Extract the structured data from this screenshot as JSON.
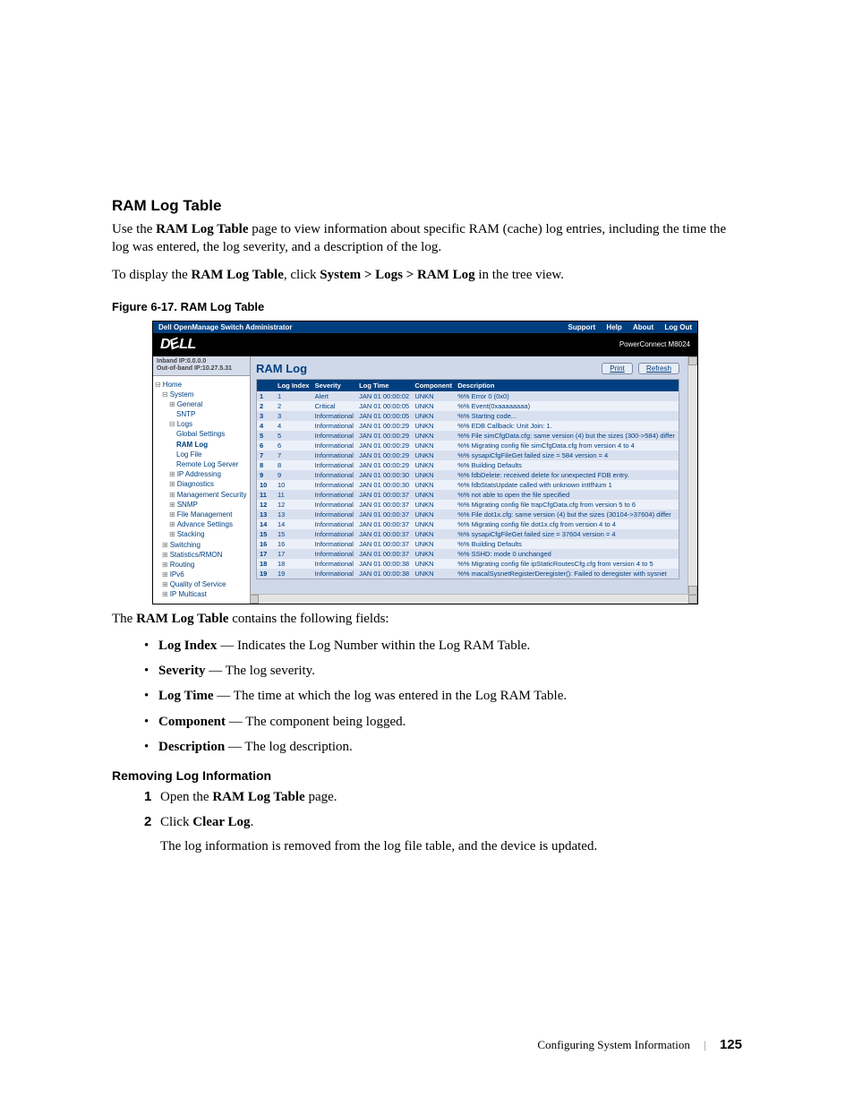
{
  "section": {
    "title": "RAM Log Table",
    "intro_pre": "Use the ",
    "intro_bold1": "RAM Log Table",
    "intro_post": " page to view information about specific RAM (cache) log entries, including the time the log was entered, the log severity, and a description of the log.",
    "display_pre": "To display the ",
    "display_bold1": "RAM Log Table",
    "display_mid": ", click ",
    "display_bold2": "System > Logs > RAM Log",
    "display_post": " in the tree view."
  },
  "fig_caption": "Figure 6-17.    RAM Log Table",
  "screenshot": {
    "titlebar_left": "Dell OpenManage Switch Administrator",
    "titlebar_links": [
      "Support",
      "Help",
      "About",
      "Log Out"
    ],
    "brand": "DELL",
    "product": "PowerConnect M8024",
    "ip_inband": "Inband IP:0.0.0.0",
    "ip_outband": "Out-of-band IP:10.27.5.31",
    "tree": [
      {
        "lvl": 0,
        "label": "Home",
        "sel": false,
        "pre": "⊟"
      },
      {
        "lvl": 1,
        "label": "System",
        "sel": false,
        "pre": "⊟"
      },
      {
        "lvl": 2,
        "label": "General",
        "sel": false,
        "pre": "⊞"
      },
      {
        "lvl": 3,
        "label": "SNTP",
        "sel": false,
        "pre": ""
      },
      {
        "lvl": 2,
        "label": "Logs",
        "sel": false,
        "pre": "⊟"
      },
      {
        "lvl": 3,
        "label": "Global Settings",
        "sel": false,
        "pre": ""
      },
      {
        "lvl": 3,
        "label": "RAM Log",
        "sel": true,
        "pre": ""
      },
      {
        "lvl": 3,
        "label": "Log File",
        "sel": false,
        "pre": ""
      },
      {
        "lvl": 3,
        "label": "Remote Log Server",
        "sel": false,
        "pre": ""
      },
      {
        "lvl": 2,
        "label": "IP Addressing",
        "sel": false,
        "pre": "⊞"
      },
      {
        "lvl": 2,
        "label": "Diagnostics",
        "sel": false,
        "pre": "⊞"
      },
      {
        "lvl": 2,
        "label": "Management Security",
        "sel": false,
        "pre": "⊞"
      },
      {
        "lvl": 2,
        "label": "SNMP",
        "sel": false,
        "pre": "⊞"
      },
      {
        "lvl": 2,
        "label": "File Management",
        "sel": false,
        "pre": "⊞"
      },
      {
        "lvl": 2,
        "label": "Advance Settings",
        "sel": false,
        "pre": "⊞"
      },
      {
        "lvl": 2,
        "label": "Stacking",
        "sel": false,
        "pre": "⊞"
      },
      {
        "lvl": 1,
        "label": "Switching",
        "sel": false,
        "pre": "⊞"
      },
      {
        "lvl": 1,
        "label": "Statistics/RMON",
        "sel": false,
        "pre": "⊞"
      },
      {
        "lvl": 1,
        "label": "Routing",
        "sel": false,
        "pre": "⊞"
      },
      {
        "lvl": 1,
        "label": "IPv6",
        "sel": false,
        "pre": "⊞"
      },
      {
        "lvl": 1,
        "label": "Quality of Service",
        "sel": false,
        "pre": "⊞"
      },
      {
        "lvl": 1,
        "label": "IP Multicast",
        "sel": false,
        "pre": "⊞"
      }
    ],
    "panel_title": "RAM Log",
    "btn_print": "Print",
    "btn_refresh": "Refresh",
    "columns": [
      "",
      "Log Index",
      "Severity",
      "Log Time",
      "Component",
      "Description"
    ],
    "rows": [
      [
        "1",
        "1",
        "Alert",
        "JAN 01 00:00:02",
        "UNKN",
        "%% Error 0 (0x0)"
      ],
      [
        "2",
        "2",
        "Critical",
        "JAN 01 00:00:05",
        "UNKN",
        "%% Event(0xaaaaaaaa)"
      ],
      [
        "3",
        "3",
        "Informational",
        "JAN 01 00:00:05",
        "UNKN",
        "%% Starting code..."
      ],
      [
        "4",
        "4",
        "Informational",
        "JAN 01 00:00:29",
        "UNKN",
        "%% EDB Callback: Unit Join: 1."
      ],
      [
        "5",
        "5",
        "Informational",
        "JAN 01 00:00:29",
        "UNKN",
        "%% File simCfgData.cfg: same version (4) but the sizes (300->584) differ"
      ],
      [
        "6",
        "6",
        "Informational",
        "JAN 01 00:00:29",
        "UNKN",
        "%% Migrating config file simCfgData.cfg from version 4 to 4"
      ],
      [
        "7",
        "7",
        "Informational",
        "JAN 01 00:00:29",
        "UNKN",
        "%% sysapiCfgFileGet failed size = 584 version = 4"
      ],
      [
        "8",
        "8",
        "Informational",
        "JAN 01 00:00:29",
        "UNKN",
        "%% Building Defaults"
      ],
      [
        "9",
        "9",
        "Informational",
        "JAN 01 00:00:30",
        "UNKN",
        "%% fdbDelete: received delete for unexpected FDB entry."
      ],
      [
        "10",
        "10",
        "Informational",
        "JAN 01 00:00:30",
        "UNKN",
        "%% fdbStatsUpdate called with unknown intIfNum 1"
      ],
      [
        "11",
        "11",
        "Informational",
        "JAN 01 00:00:37",
        "UNKN",
        "%% not able to open the file specified"
      ],
      [
        "12",
        "12",
        "Informational",
        "JAN 01 00:00:37",
        "UNKN",
        "%% Migrating config file trapCfgData.cfg from version 5 to 6"
      ],
      [
        "13",
        "13",
        "Informational",
        "JAN 01 00:00:37",
        "UNKN",
        "%% File dot1x.cfg: same version (4) but the sizes (30104->37604) differ"
      ],
      [
        "14",
        "14",
        "Informational",
        "JAN 01 00:00:37",
        "UNKN",
        "%% Migrating config file dot1x.cfg from version 4 to 4"
      ],
      [
        "15",
        "15",
        "Informational",
        "JAN 01 00:00:37",
        "UNKN",
        "%% sysapiCfgFileGet failed size = 37604 version = 4"
      ],
      [
        "16",
        "16",
        "Informational",
        "JAN 01 00:00:37",
        "UNKN",
        "%% Building Defaults"
      ],
      [
        "17",
        "17",
        "Informational",
        "JAN 01 00:00:37",
        "UNKN",
        "%% SSHD: mode 0 unchanged"
      ],
      [
        "18",
        "18",
        "Informational",
        "JAN 01 00:00:38",
        "UNKN",
        "%% Migrating config file ipStaticRoutesCfg.cfg from version 4 to 5"
      ],
      [
        "19",
        "19",
        "Informational",
        "JAN 01 00:00:38",
        "UNKN",
        "%% macalSysnetRegisterDeregister(): Failed to deregister with sysnet"
      ]
    ]
  },
  "fields_intro_pre": "The ",
  "fields_intro_bold": "RAM Log Table",
  "fields_intro_post": " contains the following fields:",
  "fields": [
    {
      "name": "Log Index",
      "desc": " — Indicates the Log Number within the Log RAM Table."
    },
    {
      "name": "Severity",
      "desc": " — The log severity."
    },
    {
      "name": "Log Time",
      "desc": " — The time at which the log was entered in the Log RAM Table."
    },
    {
      "name": "Component",
      "desc": " — The component being logged."
    },
    {
      "name": "Description",
      "desc": " — The log description."
    }
  ],
  "removing": {
    "title": "Removing Log Information",
    "step1_pre": "Open the ",
    "step1_bold": "RAM Log Table",
    "step1_post": " page.",
    "step2_pre": "Click ",
    "step2_bold": "Clear Log",
    "step2_post": ".",
    "step2_sub": "The log information is removed from the log file table, and the device is updated."
  },
  "footer": {
    "chapter": "Configuring System Information",
    "page": "125"
  }
}
